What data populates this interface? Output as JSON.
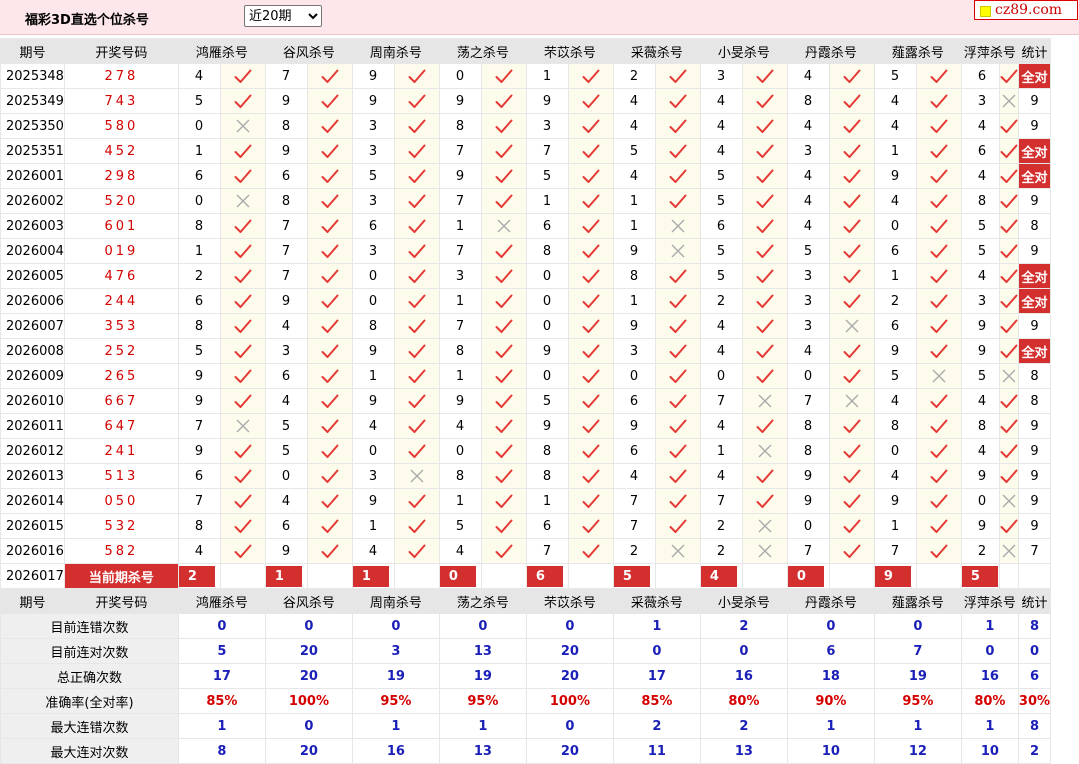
{
  "header": {
    "title": "福彩3D直选个位杀号",
    "select_value": "近20期",
    "logo": "cz89.com"
  },
  "columns": {
    "period": "期号",
    "winning": "开奖号码",
    "stats": "统计",
    "experts": [
      "鸿雁杀号",
      "谷风杀号",
      "周南杀号",
      "荡之杀号",
      "芣苡杀号",
      "采薇杀号",
      "小旻杀号",
      "丹霞杀号",
      "薤露杀号",
      "浮萍杀号"
    ]
  },
  "rows": [
    {
      "p": "2025348",
      "w": "278",
      "k": [
        "4",
        "7",
        "9",
        "0",
        "1",
        "2",
        "3",
        "4",
        "5",
        "6"
      ],
      "r": "1111111111",
      "s": "全对"
    },
    {
      "p": "2025349",
      "w": "743",
      "k": [
        "5",
        "9",
        "9",
        "9",
        "9",
        "4",
        "4",
        "8",
        "4",
        "3"
      ],
      "r": "1111111110",
      "s": "9"
    },
    {
      "p": "2025350",
      "w": "580",
      "k": [
        "0",
        "8",
        "3",
        "8",
        "3",
        "4",
        "4",
        "4",
        "4",
        "4"
      ],
      "r": "0111111111",
      "s": "9"
    },
    {
      "p": "2025351",
      "w": "452",
      "k": [
        "1",
        "9",
        "3",
        "7",
        "7",
        "5",
        "4",
        "3",
        "1",
        "6"
      ],
      "r": "1111111111",
      "s": "全对"
    },
    {
      "p": "2026001",
      "w": "298",
      "k": [
        "6",
        "6",
        "5",
        "9",
        "5",
        "4",
        "5",
        "4",
        "9",
        "4"
      ],
      "r": "1111111111",
      "s": "全对"
    },
    {
      "p": "2026002",
      "w": "520",
      "k": [
        "0",
        "8",
        "3",
        "7",
        "1",
        "1",
        "5",
        "4",
        "4",
        "8"
      ],
      "r": "0111111111",
      "s": "9"
    },
    {
      "p": "2026003",
      "w": "601",
      "k": [
        "8",
        "7",
        "6",
        "1",
        "6",
        "1",
        "6",
        "4",
        "0",
        "5"
      ],
      "r": "1110101111",
      "s": "8"
    },
    {
      "p": "2026004",
      "w": "019",
      "k": [
        "1",
        "7",
        "3",
        "7",
        "8",
        "9",
        "5",
        "5",
        "6",
        "5"
      ],
      "r": "1111101111",
      "s": "9"
    },
    {
      "p": "2026005",
      "w": "476",
      "k": [
        "2",
        "7",
        "0",
        "3",
        "0",
        "8",
        "5",
        "3",
        "1",
        "4"
      ],
      "r": "1111111111",
      "s": "全对"
    },
    {
      "p": "2026006",
      "w": "244",
      "k": [
        "6",
        "9",
        "0",
        "1",
        "0",
        "1",
        "2",
        "3",
        "2",
        "3"
      ],
      "r": "1111111111",
      "s": "全对"
    },
    {
      "p": "2026007",
      "w": "353",
      "k": [
        "8",
        "4",
        "8",
        "7",
        "0",
        "9",
        "4",
        "3",
        "6",
        "9"
      ],
      "r": "1111111011",
      "s": "9"
    },
    {
      "p": "2026008",
      "w": "252",
      "k": [
        "5",
        "3",
        "9",
        "8",
        "9",
        "3",
        "4",
        "4",
        "9",
        "9"
      ],
      "r": "1111111111",
      "s": "全对"
    },
    {
      "p": "2026009",
      "w": "265",
      "k": [
        "9",
        "6",
        "1",
        "1",
        "0",
        "0",
        "0",
        "0",
        "5",
        "5"
      ],
      "r": "1111111100",
      "s": "8"
    },
    {
      "p": "2026010",
      "w": "667",
      "k": [
        "9",
        "4",
        "9",
        "9",
        "5",
        "6",
        "7",
        "7",
        "4",
        "4"
      ],
      "r": "1111110011",
      "s": "8"
    },
    {
      "p": "2026011",
      "w": "647",
      "k": [
        "7",
        "5",
        "4",
        "4",
        "9",
        "9",
        "4",
        "8",
        "8",
        "8"
      ],
      "r": "0111111111",
      "s": "9"
    },
    {
      "p": "2026012",
      "w": "241",
      "k": [
        "9",
        "5",
        "0",
        "0",
        "8",
        "6",
        "1",
        "8",
        "0",
        "4"
      ],
      "r": "1111110111",
      "s": "9"
    },
    {
      "p": "2026013",
      "w": "513",
      "k": [
        "6",
        "0",
        "3",
        "8",
        "8",
        "4",
        "4",
        "9",
        "4",
        "9"
      ],
      "r": "1101111111",
      "s": "9"
    },
    {
      "p": "2026014",
      "w": "050",
      "k": [
        "7",
        "4",
        "9",
        "1",
        "1",
        "7",
        "7",
        "9",
        "9",
        "0"
      ],
      "r": "1111111110",
      "s": "9"
    },
    {
      "p": "2026015",
      "w": "532",
      "k": [
        "8",
        "6",
        "1",
        "5",
        "6",
        "7",
        "2",
        "0",
        "1",
        "9"
      ],
      "r": "1111110111",
      "s": "9"
    },
    {
      "p": "2026016",
      "w": "582",
      "k": [
        "4",
        "9",
        "4",
        "4",
        "7",
        "2",
        "2",
        "7",
        "7",
        "2"
      ],
      "r": "1111100110",
      "s": "7"
    }
  ],
  "current": {
    "p": "2026017",
    "label": "当前期杀号",
    "k": [
      "2",
      "1",
      "1",
      "0",
      "6",
      "5",
      "4",
      "0",
      "9",
      "5"
    ]
  },
  "stats": [
    {
      "label": "目前连错次数",
      "v": [
        "0",
        "0",
        "0",
        "0",
        "0",
        "1",
        "2",
        "0",
        "0",
        "1"
      ],
      "t": "8",
      "c": "blue"
    },
    {
      "label": "目前连对次数",
      "v": [
        "5",
        "20",
        "3",
        "13",
        "20",
        "0",
        "0",
        "6",
        "7",
        "0"
      ],
      "t": "0",
      "c": "blue"
    },
    {
      "label": "总正确次数",
      "v": [
        "17",
        "20",
        "19",
        "19",
        "20",
        "17",
        "16",
        "18",
        "19",
        "16"
      ],
      "t": "6",
      "c": "blue"
    },
    {
      "label": "准确率(全对率)",
      "v": [
        "85%",
        "100%",
        "95%",
        "95%",
        "100%",
        "85%",
        "80%",
        "90%",
        "95%",
        "80%"
      ],
      "t": "30%",
      "c": "red"
    },
    {
      "label": "最大连错次数",
      "v": [
        "1",
        "0",
        "1",
        "1",
        "0",
        "2",
        "2",
        "1",
        "1",
        "1"
      ],
      "t": "8",
      "c": "blue"
    },
    {
      "label": "最大连对次数",
      "v": [
        "8",
        "20",
        "16",
        "13",
        "20",
        "11",
        "13",
        "10",
        "12",
        "10"
      ],
      "t": "2",
      "c": "blue"
    }
  ],
  "colors": {
    "accent": "#d32f2f",
    "check": "#e53935",
    "cross": "#aaaaaa",
    "header_bg": "#fde7ea",
    "stat_blue": "#1a1fb8"
  }
}
